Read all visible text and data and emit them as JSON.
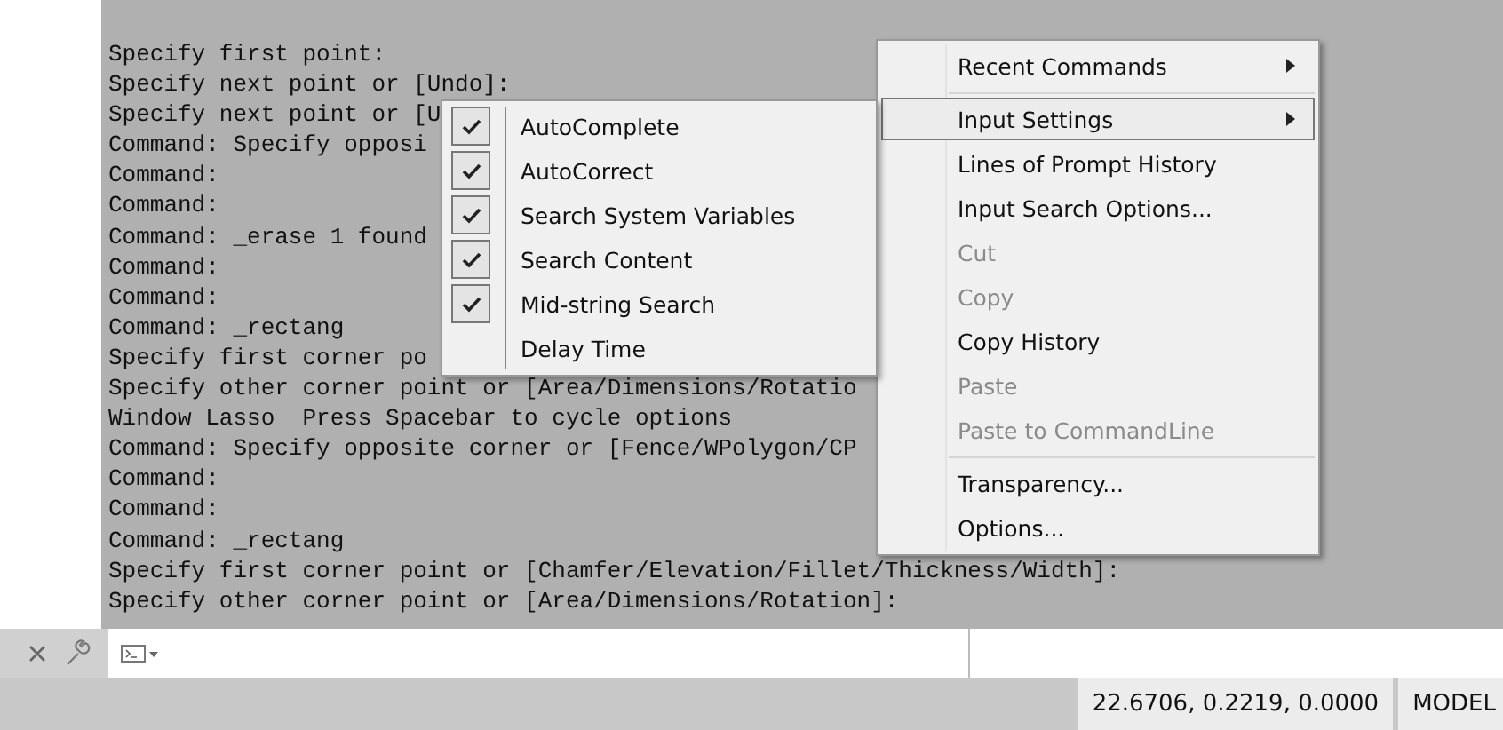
{
  "history": {
    "lines": [
      "Specify first point:",
      "Specify next point or [Undo]:",
      "Specify next point or [U",
      "Command: Specify opposi",
      "Command:",
      "Command:",
      "Command: _erase 1 found",
      "Command:",
      "Command:",
      "Command: _rectang",
      "Specify first corner po",
      "Specify other corner point or [Area/Dimensions/Rotatio",
      "Window Lasso  Press Spacebar to cycle options",
      "Command: Specify opposite corner or [Fence/WPolygon/CP",
      "Command:",
      "Command:",
      "Command: _rectang",
      "Specify first corner point or [Chamfer/Elevation/Fillet/Thickness/Width]:",
      "Specify other corner point or [Area/Dimensions/Rotation]:"
    ]
  },
  "context_menu": {
    "items": [
      {
        "kind": "item",
        "label": "Recent Commands",
        "submenu": true,
        "selected": false,
        "disabled": false
      },
      {
        "kind": "separator"
      },
      {
        "kind": "item",
        "label": "Input Settings",
        "submenu": true,
        "selected": true,
        "disabled": false
      },
      {
        "kind": "item",
        "label": "Lines of Prompt History",
        "submenu": false,
        "selected": false,
        "disabled": false
      },
      {
        "kind": "item",
        "label": "Input Search Options...",
        "submenu": false,
        "selected": false,
        "disabled": false
      },
      {
        "kind": "item",
        "label": "Cut",
        "submenu": false,
        "selected": false,
        "disabled": true
      },
      {
        "kind": "item",
        "label": "Copy",
        "submenu": false,
        "selected": false,
        "disabled": true
      },
      {
        "kind": "item",
        "label": "Copy History",
        "submenu": false,
        "selected": false,
        "disabled": false
      },
      {
        "kind": "item",
        "label": "Paste",
        "submenu": false,
        "selected": false,
        "disabled": true
      },
      {
        "kind": "item",
        "label": "Paste to CommandLine",
        "submenu": false,
        "selected": false,
        "disabled": true
      },
      {
        "kind": "separator"
      },
      {
        "kind": "item",
        "label": "Transparency...",
        "submenu": false,
        "selected": false,
        "disabled": false
      },
      {
        "kind": "item",
        "label": "Options...",
        "submenu": false,
        "selected": false,
        "disabled": false
      }
    ]
  },
  "input_settings_menu": {
    "items": [
      {
        "label": "AutoComplete",
        "checked": true
      },
      {
        "label": "AutoCorrect",
        "checked": true
      },
      {
        "label": "Search System Variables",
        "checked": true
      },
      {
        "label": "Search Content",
        "checked": true
      },
      {
        "label": "Mid-string Search",
        "checked": true
      },
      {
        "label": "Delay Time",
        "checked": false
      }
    ]
  },
  "status_bar": {
    "coordinates": "22.6706, 0.2219, 0.0000",
    "space": "MODEL"
  }
}
